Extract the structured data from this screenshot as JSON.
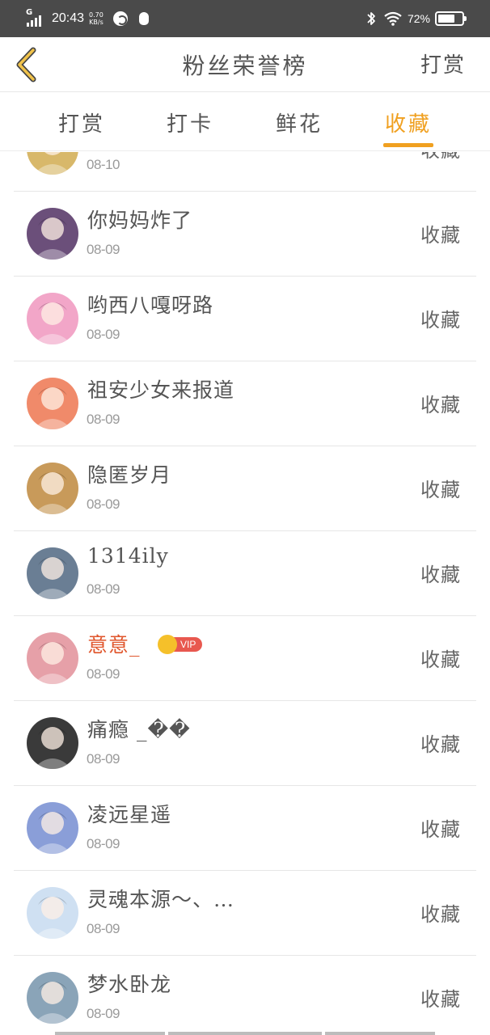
{
  "status_bar": {
    "network": "G",
    "time": "20:43",
    "speed_value": "0.70",
    "speed_unit": "KB/s",
    "battery_percent": "72%",
    "battery_level": 0.72,
    "icons": [
      "signal-icon",
      "app-notification-icon",
      "qq-penguin-icon",
      "bluetooth-icon",
      "wifi-icon",
      "battery-icon"
    ]
  },
  "header": {
    "title": "粉丝荣誉榜",
    "action_label": "打赏",
    "back_icon": "chevron-left-icon"
  },
  "tabs": [
    {
      "label": "打赏",
      "active": false
    },
    {
      "label": "打卡",
      "active": false
    },
    {
      "label": "鲜花",
      "active": false
    },
    {
      "label": "收藏",
      "active": true
    }
  ],
  "accent_color": "#f0a020",
  "fans": [
    {
      "name": "",
      "date": "08-10",
      "action": "收藏",
      "avatar_color": "#d8b86a",
      "partial": true
    },
    {
      "name": "你妈妈炸了",
      "date": "08-09",
      "action": "收藏",
      "avatar_color": "#6b4f7a"
    },
    {
      "name": "哟西八嘎呀路",
      "date": "08-09",
      "action": "收藏",
      "avatar_color": "#f2a6c8"
    },
    {
      "name": "祖安少女来报道",
      "date": "08-09",
      "action": "收藏",
      "avatar_color": "#f08a6a"
    },
    {
      "name": "隐匿岁月",
      "date": "08-09",
      "action": "收藏",
      "avatar_color": "#c89a5a"
    },
    {
      "name": "1314ily",
      "date": "08-09",
      "action": "收藏",
      "avatar_color": "#6a7e94"
    },
    {
      "name": "意意_",
      "date": "08-09",
      "action": "收藏",
      "avatar_color": "#e6a0a8",
      "vip": true,
      "vip_label": "VIP"
    },
    {
      "name": "痛瘾 _��",
      "date": "08-09",
      "action": "收藏",
      "avatar_color": "#3a3a3a"
    },
    {
      "name": "凌远星遥",
      "date": "08-09",
      "action": "收藏",
      "avatar_color": "#8a9ed8"
    },
    {
      "name": "灵魂本源～、…",
      "date": "08-09",
      "action": "收藏",
      "avatar_color": "#cfe0f2"
    },
    {
      "name": "梦水卧龙",
      "date": "08-09",
      "action": "收藏",
      "avatar_color": "#8aa4b8"
    }
  ]
}
